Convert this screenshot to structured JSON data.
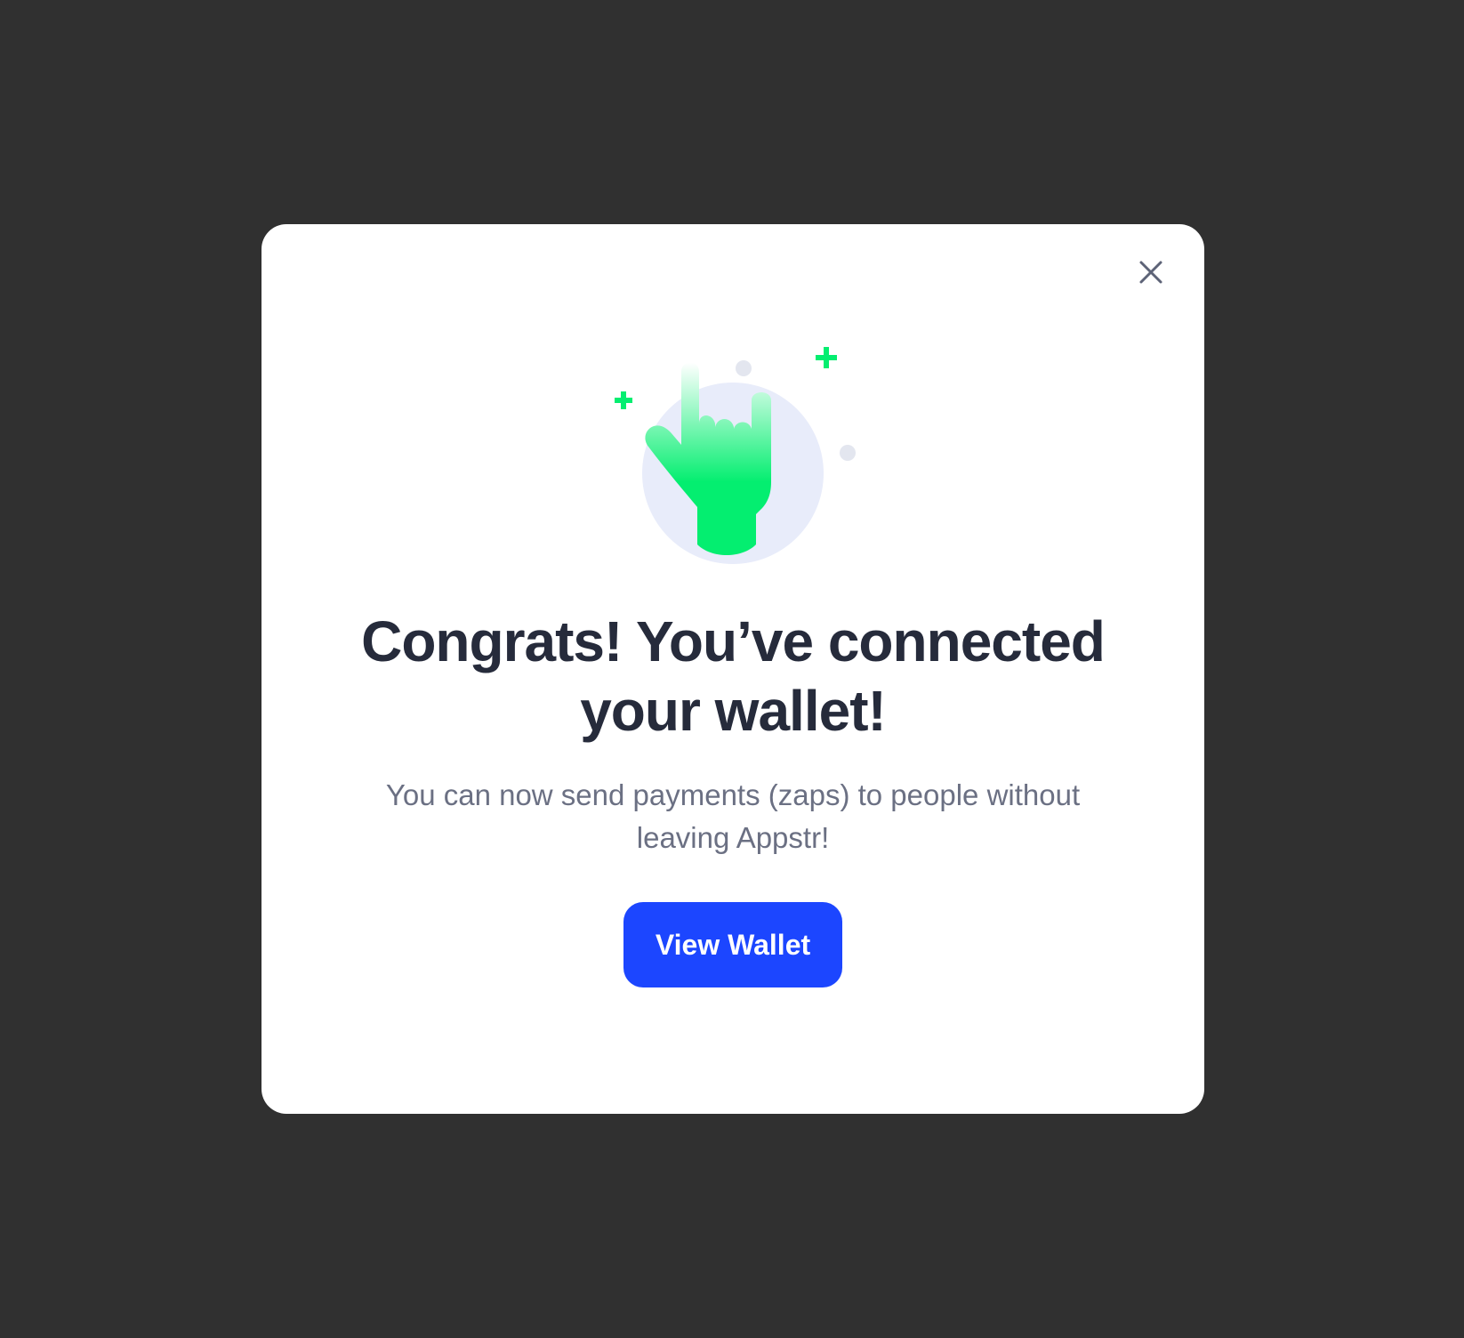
{
  "modal": {
    "close_icon": "close-icon",
    "illustration_icon": "rock-hand-icon",
    "title": "Congrats! You’ve connected your wallet!",
    "subtitle": "You can now send payments (zaps) to people without leaving Appstr!",
    "button_label": "View Wallet"
  },
  "colors": {
    "backdrop": "#303030",
    "accent": "#1c46ff",
    "success_green": "#04ee70",
    "title_text": "#262b3b",
    "body_text": "#6b7083"
  }
}
